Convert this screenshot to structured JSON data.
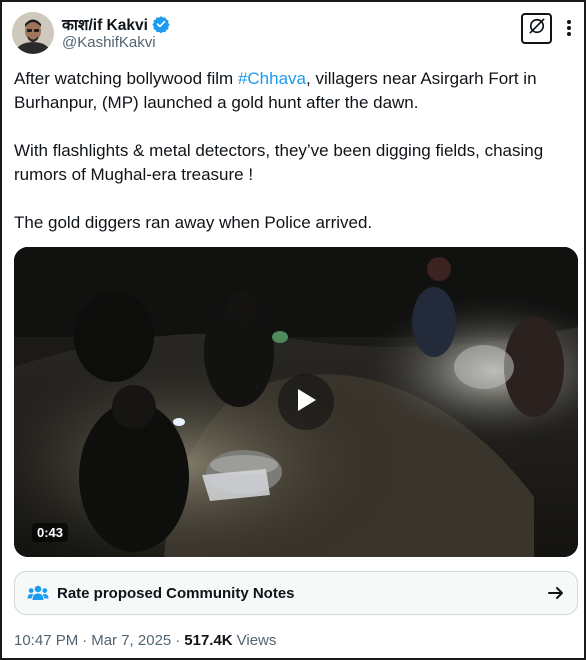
{
  "author": {
    "display_name": "काश/if Kakvi",
    "handle": "@KashifKakvi",
    "verified": true
  },
  "tweet": {
    "paragraphs": [
      {
        "before": "After watching bollywood film ",
        "hashtag": "#Chhava",
        "after": ", villagers near Asirgarh Fort in Burhanpur, (MP) launched a gold hunt after the dawn."
      },
      {
        "text": "With flashlights & metal detectors, they’ve been digging fields, chasing rumors of Mughal-era treasure !"
      },
      {
        "text": "The gold diggers ran away when Police arrived."
      }
    ]
  },
  "video": {
    "duration": "0:43"
  },
  "community_notes": {
    "label": "Rate proposed Community Notes"
  },
  "meta": {
    "time": "10:47 PM",
    "separator1": "·",
    "date": "Mar 7, 2025",
    "separator2": "·",
    "views_count": "517.4K",
    "views_label": "Views"
  },
  "colors": {
    "accent": "#1d9bf0",
    "text": "#0f1419",
    "muted": "#536471"
  },
  "icons": [
    "verified-badge-icon",
    "grok-icon",
    "more-icon",
    "play-icon",
    "community-notes-icon",
    "arrow-right-icon"
  ]
}
